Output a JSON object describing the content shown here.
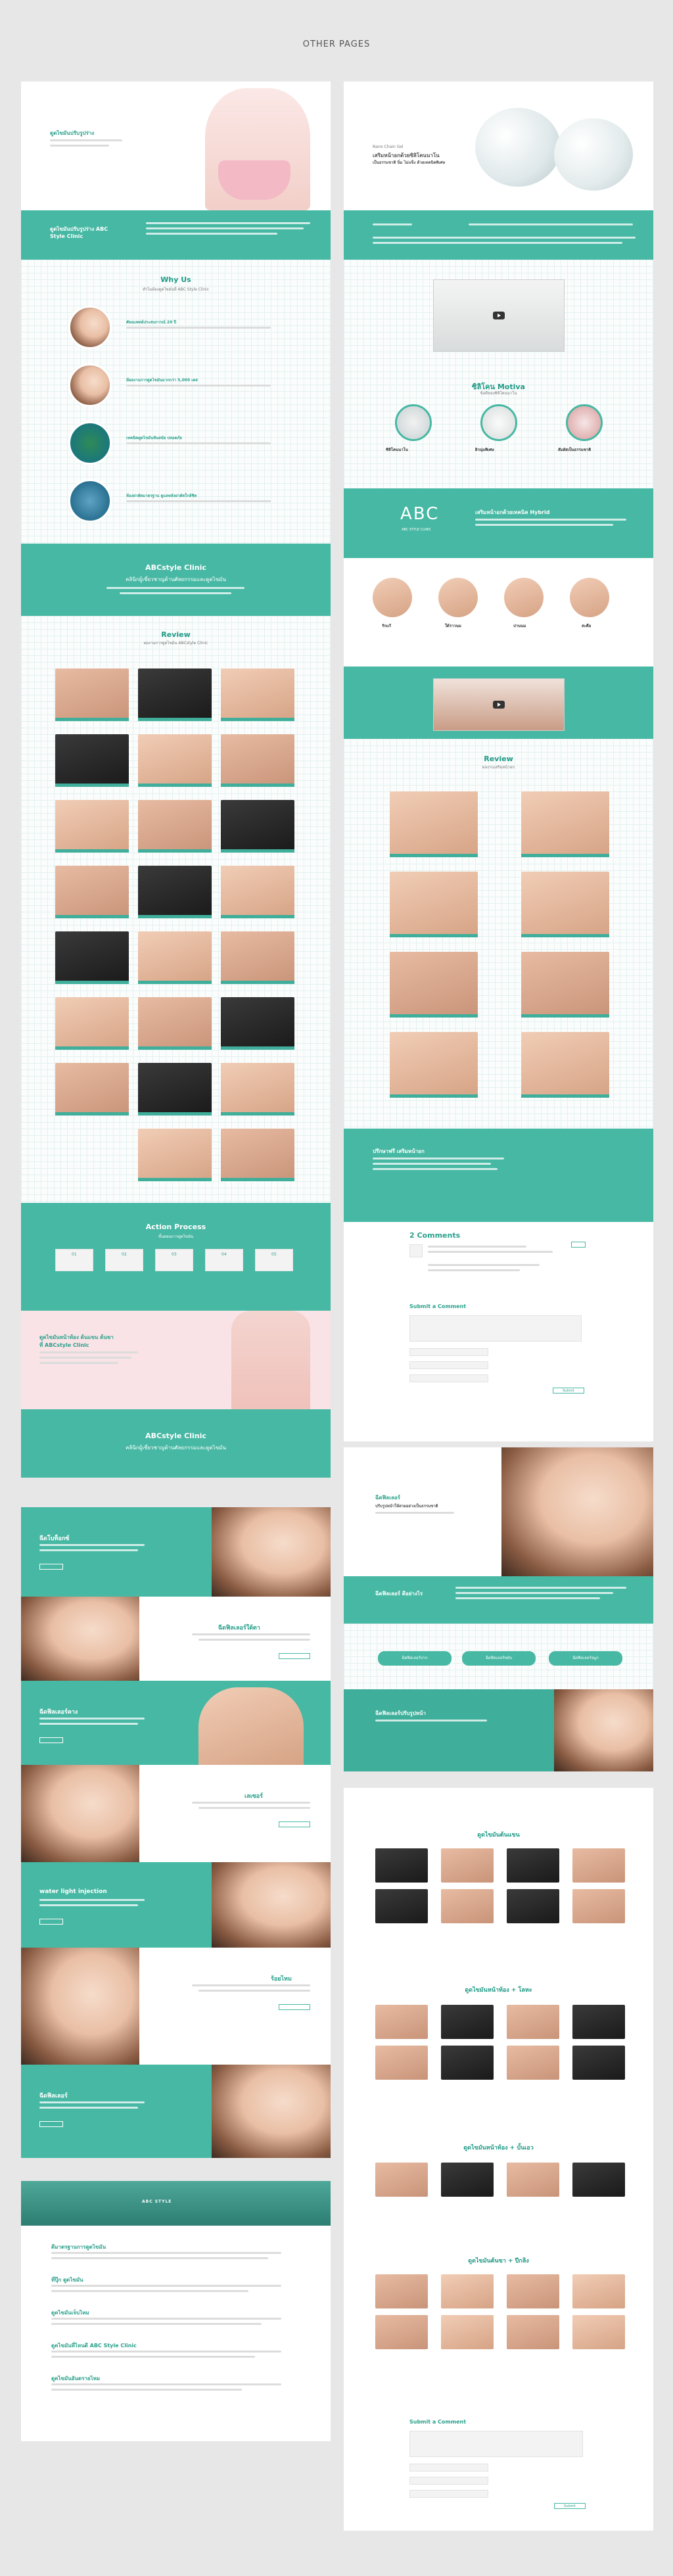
{
  "header": {
    "title": "OTHER PAGES"
  },
  "p1": {
    "hero_title": "ดูดไขมันปรับรูปร่าง",
    "hero_sub": "ลดไขมันเฉพาะส่วน ด้วยเทคนิคดูดไขมัน",
    "band_title": "ดูดไขมันปรับรูปร่าง ABC Style Clinic",
    "why_title": "Why Us",
    "why_sub": "ทำไมต้องดูดไขมันที่ ABC Style Clinic",
    "why_items": [
      "ศัลยแพทย์ประสบการณ์ 20 ปี",
      "มีผลงานการดูดไขมันมากกว่า 5,000 เคส",
      "เทคนิคดูดไขมันทันสมัย ปลอดภัย",
      "ห้องผ่าตัดมาตรฐาน ดูแลหลังผ่าตัดใกล้ชิด"
    ],
    "abc_title": "ABCstyle Clinic",
    "abc_sub": "คลินิกผู้เชี่ยวชาญด้านศัลยกรรมและดูดไขมัน",
    "review_title": "Review",
    "review_sub": "ผลงานการดูดไขมัน ABCstyle Clinic",
    "process_title": "Action Process",
    "process_sub": "ขั้นตอนการดูดไขมัน",
    "steps": [
      "01",
      "02",
      "03",
      "04",
      "05"
    ],
    "promo_title": "ดูดไขมันหน้าท้อง ต้นแขน ต้นขา",
    "promo_sub": "ที่ ABCstyle Clinic",
    "abc2_title": "ABCstyle Clinic",
    "abc2_sub": "คลินิกผู้เชี่ยวชาญด้านศัลยกรรมและดูดไขมัน"
  },
  "p2": {
    "hero_small": "Nano Chain Gel",
    "hero_title": "เสริมหน้าอกด้วยซิลิโคนนาโน",
    "hero_sub": "เป็นธรรมชาติ นิ่ม ไม่แข็ง ด้วยเทคนิคพิเศษ",
    "types_title": "ซิลิโคน Motiva",
    "types_sub": "ข้อดีของซิลิโคนนาโน",
    "types": [
      "ซิลิโคนนาโน",
      "ผิวนุ่มพิเศษ",
      "สัมผัสเป็นธรรมชาติ"
    ],
    "abc_logo": "ABC",
    "abc_logo_sub": "ABC STYLE CLINIC",
    "tech_title": "เสริมหน้าอกด้วยเทคนิค Hybrid",
    "positions": [
      "รักแร้",
      "ใต้ราวนม",
      "ปานนม",
      "สะดือ"
    ],
    "review_title": "Review",
    "review_sub": "ผลงานเสริมหน้าอก",
    "band_title": "ปรึกษาฟรี เสริมหน้าอก",
    "comments_title": "2 Comments",
    "submit_title": "Submit a Comment",
    "submit_btn": "Submit"
  },
  "p3": {
    "rows": [
      "ฉีดโบท็อกซ์",
      "ฉีดฟิลเลอร์ใต้ตา",
      "ฉีดฟิลเลอร์คาง",
      "เลเซอร์",
      "water light injection",
      "ร้อยไหม",
      "ฉีดฟิลเลอร์"
    ],
    "more": "More"
  },
  "p4": {
    "hero_title": "ฉีดฟิลเลอร์",
    "hero_sub": "ปรับรูปหน้าให้สวยอย่างเป็นธรรมชาติ",
    "band_title": "ฉีดฟิลเลอร์ ดีอย่างไร",
    "buttons": [
      "ฉีดฟิลเลอร์ปาก",
      "ฉีดฟิลเลอร์ขมับ",
      "ฉีดฟิลเลอร์จมูก"
    ],
    "foot_title": "ฉีดฟิลเลอร์ปรับรูปหน้า"
  },
  "p5": {
    "banner_text": "ABC STYLE",
    "faq": [
      "ดีมาตรฐานการดูดไขมัน",
      "ที่ปุ๊ก ดูดไขมัน",
      "ดูดไขมันเจ็บไหม",
      "ดูดไขมันที่ไหนดี ABC Style Clinic",
      "ดูดไขมันอันตรายไหม"
    ]
  },
  "p6": {
    "sections": [
      "ดูดไขมันต้นแขน",
      "ดูดไขมันหน้าท้อง + โลหะ",
      "ดูดไขมันหน้าท้อง + บั้นเอว",
      "ดูดไขมันต้นขา + ปีกลิง"
    ],
    "submit_title": "Submit a Comment",
    "submit_btn": "Submit"
  }
}
